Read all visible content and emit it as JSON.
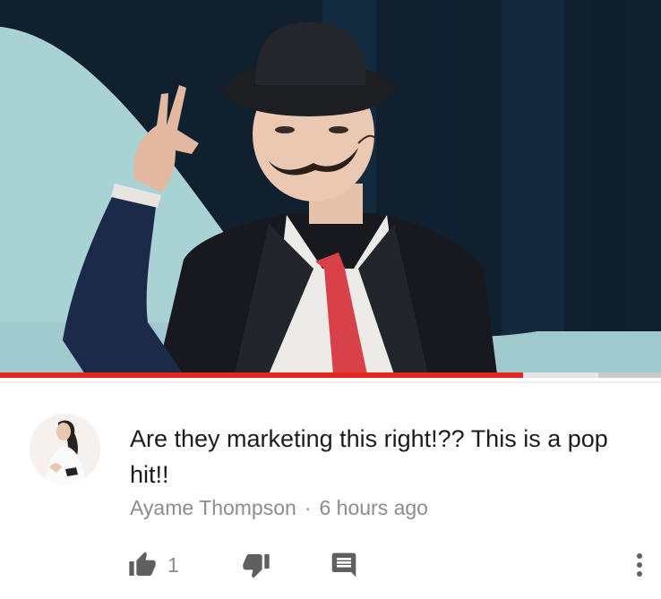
{
  "video": {
    "played_fraction": 0.792,
    "buffered_fraction": 0.905
  },
  "comment": {
    "text": "Are they marketing this right!?? This is a pop hit!!",
    "author": "Ayame Thompson",
    "separator": "·",
    "time": "6 hours ago",
    "like_count": "1"
  },
  "icons": {
    "like": "thumbs-up-icon",
    "dislike": "thumbs-down-icon",
    "reply": "reply-comment-icon",
    "menu": "more-vert-icon"
  },
  "colors": {
    "progress_played": "#e52521",
    "text_primary": "#1c1c1c",
    "text_secondary": "#8c8c8c",
    "icon": "#5f5f5f"
  }
}
